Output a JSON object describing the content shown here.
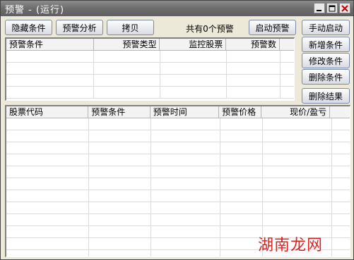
{
  "window": {
    "title": "预警 - (运行)"
  },
  "toolbar": {
    "hide_conditions": "隐藏条件",
    "alert_analysis": "预警分析",
    "copy": "拷贝",
    "status": "共有0个预警",
    "start_alert": "启动预警"
  },
  "side_buttons": {
    "manual_start": "手动启动",
    "add_condition": "新增条件",
    "modify_condition": "修改条件",
    "delete_condition": "删除条件",
    "delete_result": "删除结果"
  },
  "conditions_table": {
    "columns": [
      "预警条件",
      "预警类型",
      "监控股票",
      "预警数"
    ],
    "rows": []
  },
  "results_table": {
    "columns": [
      "股票代码",
      "预警条件",
      "预警时间",
      "预警价格",
      "现价/盈亏"
    ],
    "rows": []
  },
  "watermark": "湖南龙网"
}
